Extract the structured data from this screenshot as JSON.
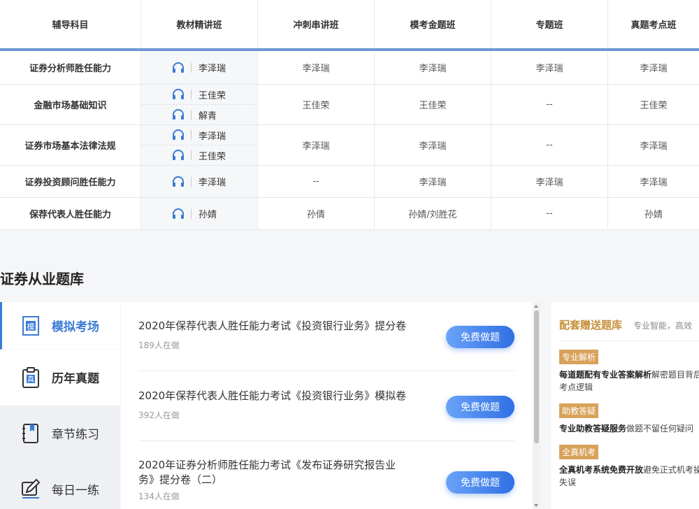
{
  "table": {
    "headers": [
      "辅导科目",
      "教材精讲班",
      "冲刺串讲班",
      "模考金题班",
      "专题班",
      "真题考点班"
    ],
    "rows": [
      {
        "subject": "证券分析师胜任能力",
        "teachers": [
          "李泽瑞"
        ],
        "cols": [
          "李泽瑞",
          "李泽瑞",
          "李泽瑞",
          "李泽瑞"
        ]
      },
      {
        "subject": "金融市场基础知识",
        "teachers": [
          "王佳荣",
          "解青"
        ],
        "cols": [
          "王佳荣",
          "王佳荣",
          "--",
          "王佳荣"
        ]
      },
      {
        "subject": "证券市场基本法律法规",
        "teachers": [
          "李泽瑞",
          "王佳荣"
        ],
        "cols": [
          "李泽瑞",
          "李泽瑞",
          "--",
          "李泽瑞"
        ]
      },
      {
        "subject": "证券投资顾问胜任能力",
        "teachers": [
          "李泽瑞"
        ],
        "cols": [
          "--",
          "李泽瑞",
          "李泽瑞",
          "李泽瑞"
        ]
      },
      {
        "subject": "保荐代表人胜任能力",
        "teachers": [
          "孙婧"
        ],
        "cols": [
          "孙倩",
          "孙婧/刘胜花",
          "--",
          "孙婧"
        ]
      }
    ]
  },
  "section": {
    "title": "证券从业题库"
  },
  "sidebar": [
    {
      "label": "模拟考场",
      "icon": "exam-paper-icon",
      "active": true
    },
    {
      "label": "历年真题",
      "icon": "clipboard-icon",
      "active": false
    },
    {
      "label": "章节练习",
      "icon": "notebook-icon",
      "active": false
    },
    {
      "label": "每日一练",
      "icon": "pencil-edit-icon",
      "active": false
    }
  ],
  "questions": [
    {
      "title": "2020年保荐代表人胜任能力考试《投资银行业务》提分卷",
      "count": "189人在做",
      "button": "免费做题"
    },
    {
      "title": "2020年保荐代表人胜任能力考试《投资银行业务》模拟卷",
      "count": "392人在做",
      "button": "免费做题"
    },
    {
      "title": "2020年证券分析师胜任能力考试《发布证券研究报告业务》提分卷（二）",
      "count": "134人在做",
      "button": "免费做题"
    }
  ],
  "promo": {
    "title": "配套赠送题库",
    "subtitle": "专业智能，高效",
    "features": [
      {
        "tag": "专业解析",
        "bold": "每道题配有专业答案解析",
        "text": "解密题目背后",
        "line2": "考点逻辑"
      },
      {
        "tag": "助教答疑",
        "bold": "专业助教答疑服务",
        "text": "做题不留任何疑问",
        "line2": ""
      },
      {
        "tag": "全真机考",
        "bold": "全真机考系统免费开放",
        "text": "避免正式机考操",
        "line2": "失误"
      }
    ]
  },
  "colors": {
    "accent": "#3a7bd5",
    "header_rule": "#6f95d6",
    "promo_gold": "#d8a25a"
  }
}
